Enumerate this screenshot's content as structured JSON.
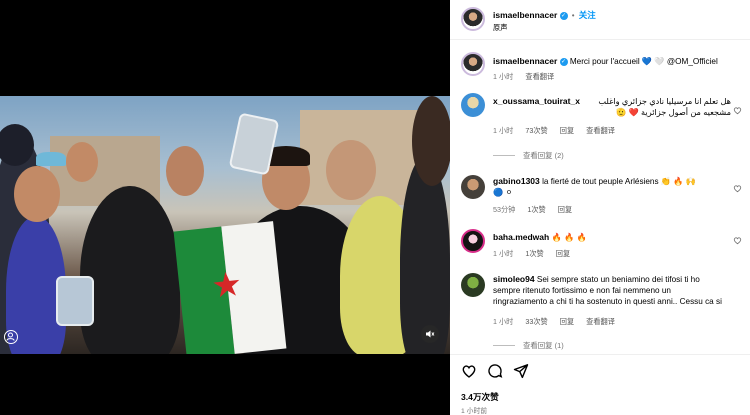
{
  "header": {
    "username": "ismaelbennacer",
    "follow_label": "关注",
    "subtitle": "原声"
  },
  "caption": {
    "username": "ismaelbennacer",
    "text": "Merci pour l'accueil 💙 🤍 @OM_Officiel",
    "time": "1 小时",
    "translate": "查看翻译"
  },
  "comments": [
    {
      "username": "x_oussama_touirat_x",
      "text_line1": "هل تعلم انا مرسيليا نادي جزائري واغلب",
      "text_line2": "مشجعيه من أصول جزائرية ❤️ 🫡",
      "time": "1 小时",
      "likes": "73次赞",
      "reply": "回复",
      "translate": "查看翻译",
      "view_replies": "查看回复 (2)"
    },
    {
      "username": "gabino1303",
      "text_line1": "la fierté de tout peuple Arlésiens 👏 🔥 🙌",
      "text_line2": "🔵 ⚪",
      "time": "53分钟",
      "likes": "1次赞",
      "reply": "回复"
    },
    {
      "username": "baha.medwah",
      "text_line1": "🔥 🔥 🔥",
      "time": "1 小时",
      "likes": "1次赞",
      "reply": "回复"
    },
    {
      "username": "simoleo94",
      "text_line1": "Sei sempre stato un beniamino dei tifosi ti ho",
      "text_line2": "sempre ritenuto fortissimo e non fai nemmeno un",
      "text_line3": "ringraziamento a chi ti ha sostenuto in questi anni.. Cessu ca si",
      "time": "1 小时",
      "likes": "33次赞",
      "reply": "回复",
      "translate": "查看翻译",
      "view_replies": "查看回复 (1)"
    }
  ],
  "footer": {
    "likes": "3.4万次赞",
    "time": "1 小时前"
  },
  "colors": {
    "link": "#0095f6",
    "verified": "#1d9bf0",
    "muted": "#737373"
  }
}
